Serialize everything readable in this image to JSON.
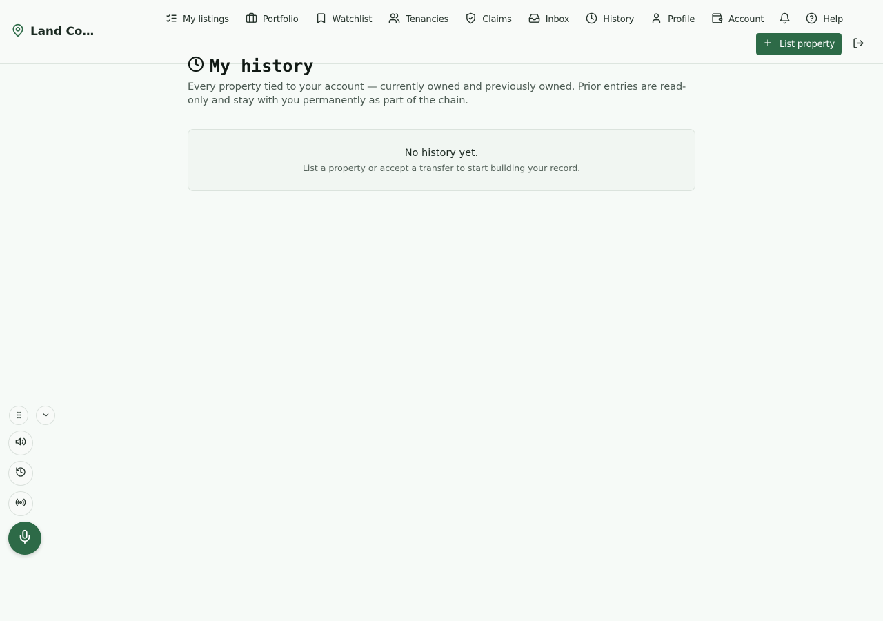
{
  "brand": {
    "name": "Land Comp..."
  },
  "nav": {
    "items": [
      {
        "label": "My listings",
        "icon": "list-check-icon"
      },
      {
        "label": "Portfolio",
        "icon": "briefcase-icon"
      },
      {
        "label": "Watchlist",
        "icon": "bookmark-icon"
      },
      {
        "label": "Tenancies",
        "icon": "users-icon"
      },
      {
        "label": "Claims",
        "icon": "shield-check-icon"
      },
      {
        "label": "Inbox",
        "icon": "inbox-icon"
      },
      {
        "label": "History",
        "icon": "clock-icon"
      },
      {
        "label": "Profile",
        "icon": "user-icon"
      },
      {
        "label": "Account",
        "icon": "wallet-icon"
      },
      {
        "label": "Help",
        "icon": "help-circle-icon"
      }
    ],
    "notifications_icon": "bell-icon",
    "list_property_label": "List property",
    "logout_icon": "logout-icon"
  },
  "page": {
    "title": "My history",
    "subtitle": "Every property tied to your account — currently owned and previously owned. Prior entries are read-only and stay with you permanently as part of the chain.",
    "empty_state": {
      "title": "No history yet.",
      "text": "List a property or accept a transfer to start building your record."
    }
  },
  "colors": {
    "accent": "#2d6a47",
    "background": "#f6faf7"
  }
}
